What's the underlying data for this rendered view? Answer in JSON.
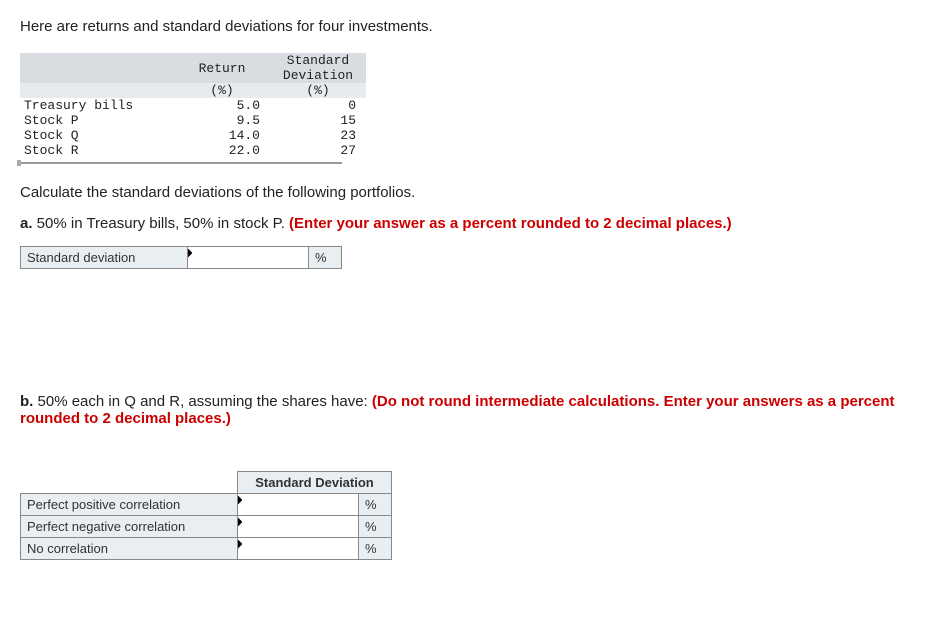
{
  "intro": "Here are returns and standard deviations for four investments.",
  "chart_data": {
    "type": "table",
    "title": "",
    "headers": {
      "empty": "",
      "return_line1": "Return",
      "return_line2": "(%)",
      "sd_line1": "Standard",
      "sd_line2": "Deviation",
      "sd_line3": "(%)"
    },
    "rows": [
      {
        "name": "Treasury bills",
        "return": "5.0",
        "sd": "0"
      },
      {
        "name": "Stock P",
        "return": "9.5",
        "sd": "15"
      },
      {
        "name": "Stock Q",
        "return": "14.0",
        "sd": "23"
      },
      {
        "name": "Stock R",
        "return": "22.0",
        "sd": "27"
      }
    ]
  },
  "calc_prompt": "Calculate the standard deviations of the following portfolios.",
  "part_a": {
    "label": "a.",
    "text": " 50% in Treasury bills, 50% in stock P. ",
    "hint": "(Enter your answer as a percent rounded to 2 decimal places.)",
    "row_label": "Standard deviation",
    "unit": "%"
  },
  "part_b": {
    "label": "b.",
    "text": " 50% each in Q and R, assuming the shares have: ",
    "hint": "(Do not round intermediate calculations. Enter your answers as a percent rounded to 2 decimal places.)",
    "header": "Standard Deviation",
    "rows": [
      {
        "label": "Perfect positive correlation",
        "unit": "%"
      },
      {
        "label": "Perfect negative correlation",
        "unit": "%"
      },
      {
        "label": "No correlation",
        "unit": "%"
      }
    ]
  }
}
